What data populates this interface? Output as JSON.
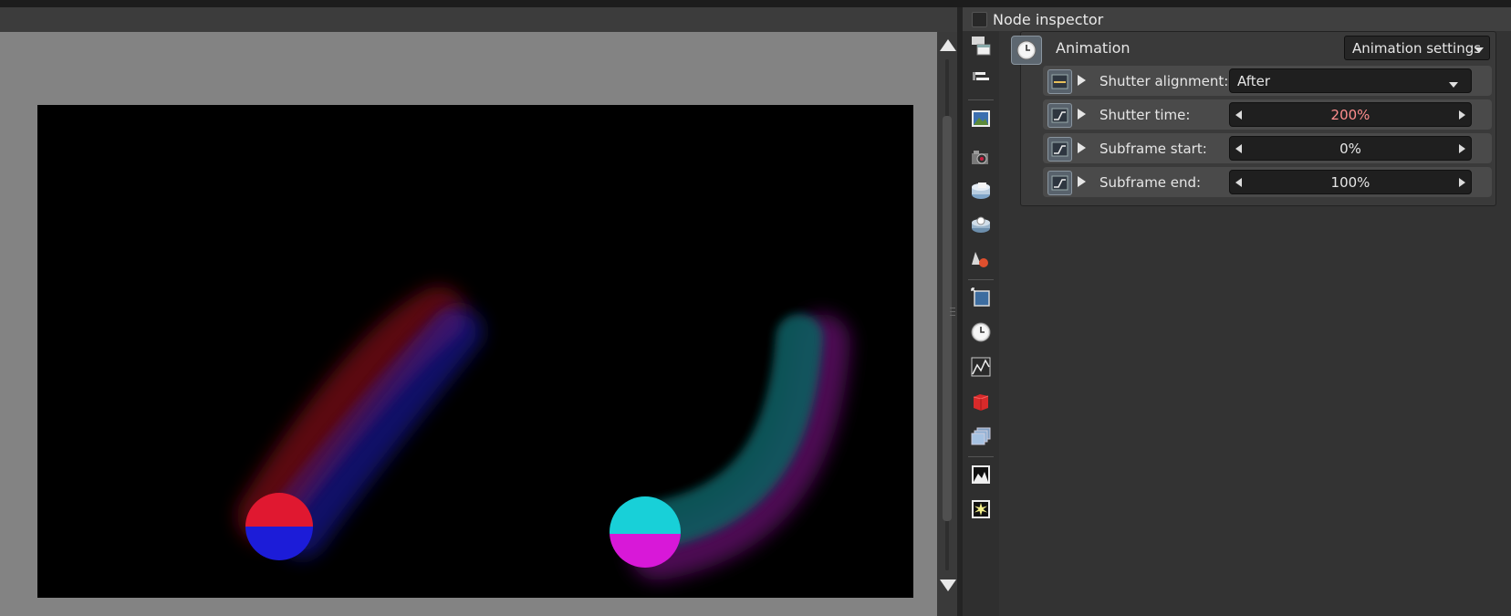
{
  "inspector": {
    "title": "Node inspector"
  },
  "toolbar": {
    "icons": [
      "node-graph-icon",
      "list-icon",
      "image-icon",
      "camera-icon",
      "environment-icon",
      "render-target-icon",
      "material-icon",
      "transform-icon",
      "clock-icon",
      "texture-icon",
      "object-icon",
      "layers-icon",
      "imager-icon",
      "postprocess-icon"
    ]
  },
  "animation": {
    "label": "Animation",
    "settings_button": "Animation settings",
    "properties": [
      {
        "label": "Shutter alignment:",
        "value": "After",
        "kind": "dropdown"
      },
      {
        "label": "Shutter time:",
        "value": "200%",
        "kind": "stepper",
        "highlight": true
      },
      {
        "label": "Subframe start:",
        "value": "0%",
        "kind": "stepper"
      },
      {
        "label": "Subframe end:",
        "value": "100%",
        "kind": "stepper"
      }
    ]
  },
  "colors": {
    "highlight_value": "#ff8e8e",
    "sphere1_top": "#e01830",
    "sphere1_bottom": "#1c1cd8",
    "sphere2_top": "#18d0d8",
    "sphere2_bottom": "#d818d8"
  }
}
